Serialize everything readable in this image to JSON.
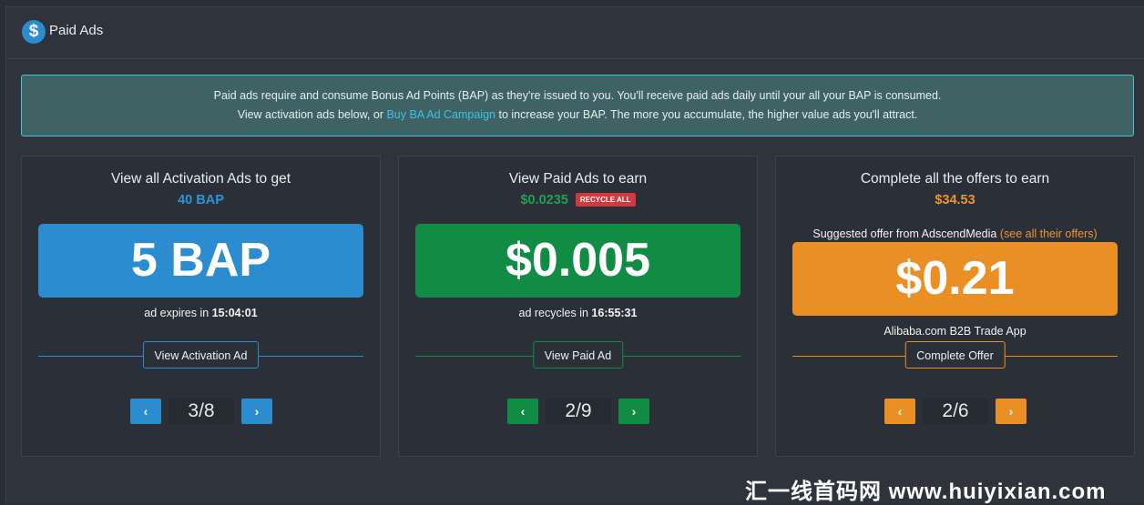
{
  "header": {
    "title": "Paid Ads",
    "icon": "dollar-circle-icon",
    "icon_glyph": "$"
  },
  "info": {
    "line1": "Paid ads require and consume Bonus Ad Points (BAP) as they're issued to you. You'll receive paid ads daily until your all your BAP is consumed.",
    "line2_prefix": "View activation ads below, or ",
    "line2_link": "Buy BA Ad Campaign",
    "line2_suffix": " to increase your BAP. The more you accumulate, the higher value ads you'll attract."
  },
  "cards": [
    {
      "title": "View all Activation Ads to get",
      "subtitle": "40 BAP",
      "big_value": "5 BAP",
      "note_prefix": "ad expires in ",
      "note_value": "15:04:01",
      "action": "View Activation Ad",
      "page": "3/8",
      "prev_glyph": "‹",
      "next_glyph": "›",
      "color": "#2b8ccf"
    },
    {
      "title": "View Paid Ads to earn",
      "subtitle": "$0.0235",
      "badge": "RECYCLE ALL",
      "big_value": "$0.005",
      "note_prefix": "ad recycles in ",
      "note_value": "16:55:31",
      "action": "View Paid Ad",
      "page": "2/9",
      "prev_glyph": "‹",
      "next_glyph": "›",
      "color": "#118c45"
    },
    {
      "title": "Complete all the offers to earn",
      "subtitle": "$34.53",
      "suggested_prefix": "Suggested offer from AdscendMedia ",
      "suggested_link": "(see all their offers)",
      "big_value": "$0.21",
      "offer_name": "Alibaba.com B2B Trade App",
      "action": "Complete Offer",
      "page": "2/6",
      "prev_glyph": "‹",
      "next_glyph": "›",
      "color": "#ea8f23"
    }
  ],
  "watermark": "汇一线首码网 www.huiyixian.com",
  "colors": {
    "accent_blue": "#2b8ccf",
    "accent_green": "#118c45",
    "accent_orange": "#ea8f23",
    "info_border": "#3fc8dc",
    "badge_red": "#d0393d"
  }
}
